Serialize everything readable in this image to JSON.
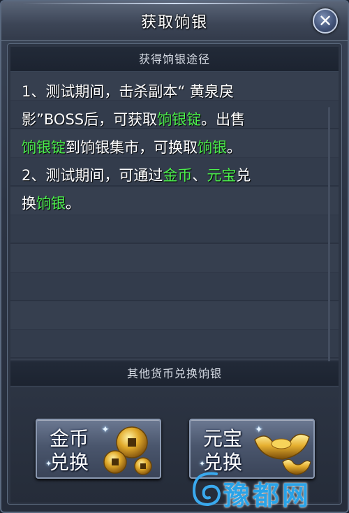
{
  "window": {
    "title": "获取饷银"
  },
  "close": {
    "glyph": "✕"
  },
  "section1": {
    "header": "获得饷银途径",
    "lines": [
      [
        {
          "t": "1、测试期间，击杀副本“ 黄泉戾",
          "hl": false
        }
      ],
      [
        {
          "t": "影”BOSS后，可获取",
          "hl": false
        },
        {
          "t": "饷银锭",
          "hl": true
        },
        {
          "t": "。出售",
          "hl": false
        }
      ],
      [
        {
          "t": "饷银锭",
          "hl": true
        },
        {
          "t": "到饷银集市，可换取",
          "hl": false
        },
        {
          "t": "饷银",
          "hl": true
        },
        {
          "t": "。",
          "hl": false
        }
      ],
      [
        {
          "t": "2、测试期间，可通过",
          "hl": false
        },
        {
          "t": "金币",
          "hl": true
        },
        {
          "t": "、",
          "hl": false
        },
        {
          "t": "元宝",
          "hl": true
        },
        {
          "t": "兑",
          "hl": false
        }
      ],
      [
        {
          "t": "换",
          "hl": false
        },
        {
          "t": "饷银",
          "hl": true
        },
        {
          "t": "。",
          "hl": false
        }
      ]
    ]
  },
  "section2": {
    "header": "其他货币兑换饷银",
    "buttons": [
      {
        "line1": "金币",
        "line2": "兑换",
        "icon": "gold-coins-icon"
      },
      {
        "line1": "元宝",
        "line2": "兑换",
        "icon": "gold-ingot-icon"
      }
    ]
  },
  "watermark": {
    "text": "豫都网"
  },
  "colors": {
    "highlight": "#4cf04c",
    "text": "#ffffff",
    "accent": "#2aa3e8"
  }
}
